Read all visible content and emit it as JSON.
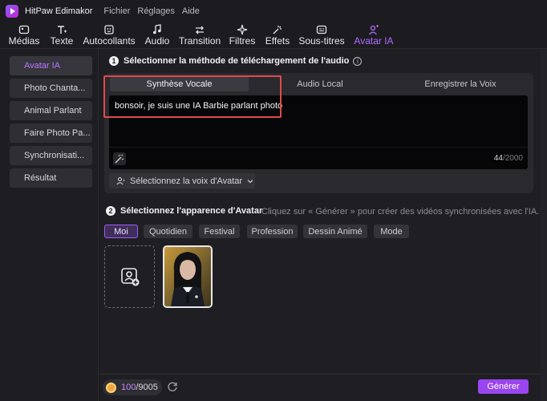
{
  "app": {
    "name": "HitPaw Edimakor",
    "menu": [
      "Fichier",
      "Réglages",
      "Aide"
    ]
  },
  "toolbar": {
    "items": [
      {
        "label": "Médias",
        "icon": "media-icon"
      },
      {
        "label": "Texte",
        "icon": "text-icon"
      },
      {
        "label": "Autocollants",
        "icon": "sticker-icon"
      },
      {
        "label": "Audio",
        "icon": "music-note-icon"
      },
      {
        "label": "Transition",
        "icon": "transition-icon"
      },
      {
        "label": "Filtres",
        "icon": "filter-icon"
      },
      {
        "label": "Effets",
        "icon": "effects-icon"
      },
      {
        "label": "Sous-titres",
        "icon": "subtitles-icon"
      },
      {
        "label": "Avatar IA",
        "icon": "avatar-ai-icon",
        "active": true
      }
    ]
  },
  "sidebar": {
    "items": [
      {
        "label": "Avatar IA",
        "active": true
      },
      {
        "label": "Photo Chanta..."
      },
      {
        "label": "Animal Parlant"
      },
      {
        "label": "Faire Photo Pa..."
      },
      {
        "label": "Synchronisati..."
      },
      {
        "label": "Résultat"
      }
    ]
  },
  "step1": {
    "number": "1",
    "title": "Sélectionner la méthode de téléchargement de l'audio",
    "tabs": [
      "Synthèse Vocale",
      "Audio Local",
      "Enregistrer la Voix"
    ],
    "active_tab": "Synthèse Vocale",
    "text_value": "bonsoir, je suis une IA Barbie parlant photo",
    "char_count": "44",
    "char_limit": "/2000",
    "voice_select_label": "Sélectionnez la voix d'Avatar"
  },
  "step2": {
    "number": "2",
    "title": "Sélectionnez l'apparence d'Avatar",
    "hint": "Cliquez sur « Générer » pour créer des vidéos synchronisées avec l'IA.",
    "chips": [
      "Moi",
      "Quotidien",
      "Festival",
      "Profession",
      "Dessin Animé",
      "Mode"
    ],
    "active_chip": "Moi"
  },
  "footer": {
    "credits_used": "100",
    "credits_total": "/9005",
    "generate_label": "Générer"
  },
  "colors": {
    "accent": "#9a46f0",
    "active_text": "#b36bff",
    "highlight_box": "#e04b48"
  }
}
